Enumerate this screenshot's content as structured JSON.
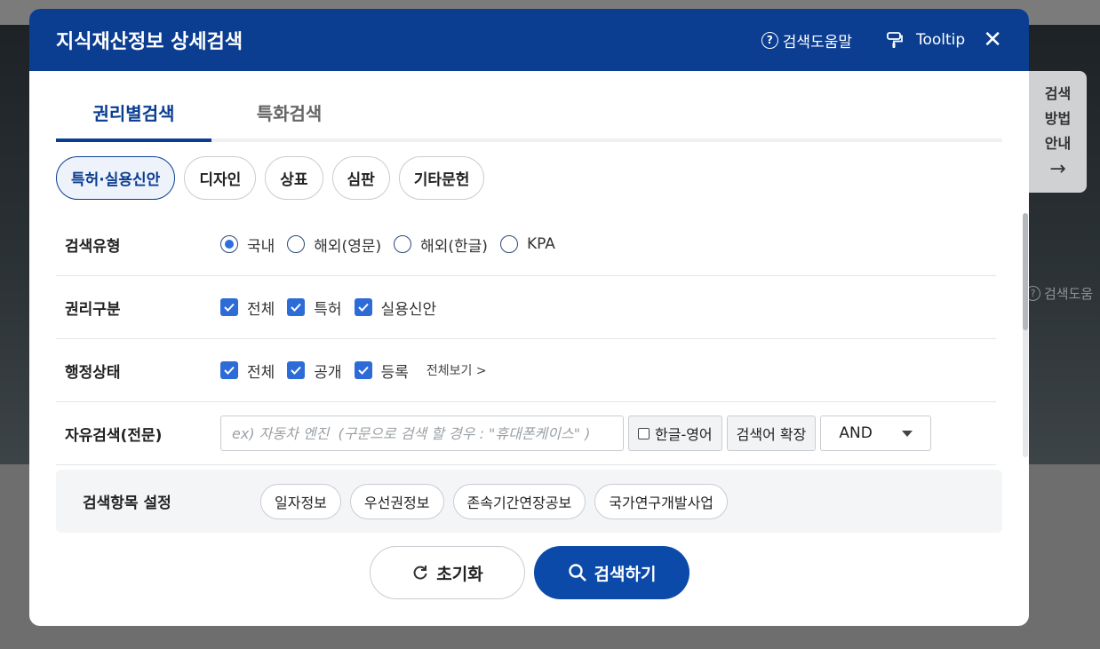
{
  "background": {
    "help_text": "검색도움",
    "side_guide": {
      "lines": [
        "검색",
        "방법",
        "안내"
      ],
      "arrow": "→"
    }
  },
  "modal": {
    "title": "지식재산정보 상세검색",
    "help_link": "검색도움말",
    "tooltip_link": "Tooltip",
    "close": "✕",
    "colors": {
      "header": "#0b3d91",
      "accent": "#2d6bd6",
      "search_button": "#0b4aa8"
    }
  },
  "tabs": [
    {
      "label": "권리별검색",
      "active": true
    },
    {
      "label": "특화검색",
      "active": false
    }
  ],
  "categories": [
    {
      "label": "특허·실용신안",
      "active": true
    },
    {
      "label": "디자인",
      "active": false
    },
    {
      "label": "상표",
      "active": false
    },
    {
      "label": "심판",
      "active": false
    },
    {
      "label": "기타문헌",
      "active": false
    }
  ],
  "form": {
    "search_type": {
      "label": "검색유형",
      "options": [
        {
          "label": "국내",
          "selected": true
        },
        {
          "label": "해외(영문)",
          "selected": false
        },
        {
          "label": "해외(한글)",
          "selected": false
        },
        {
          "label": "KPA",
          "selected": false
        }
      ]
    },
    "right_type": {
      "label": "권리구분",
      "options": [
        {
          "label": "전체",
          "checked": true
        },
        {
          "label": "특허",
          "checked": true
        },
        {
          "label": "실용신안",
          "checked": true
        }
      ]
    },
    "admin_status": {
      "label": "행정상태",
      "options": [
        {
          "label": "전체",
          "checked": true
        },
        {
          "label": "공개",
          "checked": true
        },
        {
          "label": "등록",
          "checked": true
        }
      ],
      "more": "전체보기 >"
    },
    "free_search": {
      "label": "자유검색(전문)",
      "value": "",
      "placeholder": "ex) 자동차 엔진  (구문으로 검색 할 경우 : \"휴대폰케이스\" )",
      "korean_english": "한글-영어",
      "expand": "검색어 확장",
      "operator": "AND"
    }
  },
  "settings": {
    "label": "검색항목 설정",
    "items": [
      "일자정보",
      "우선권정보",
      "존속기간연장공보",
      "국가연구개발사업"
    ]
  },
  "actions": {
    "reset": "초기화",
    "search": "검색하기"
  }
}
